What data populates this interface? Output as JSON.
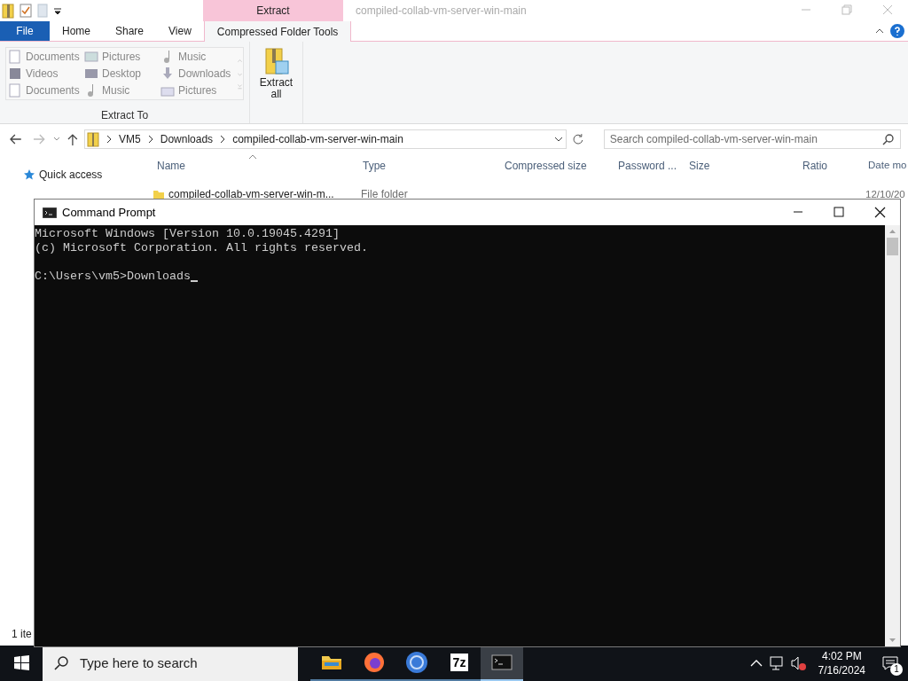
{
  "explorer": {
    "context_tab": "Extract",
    "title": "compiled-collab-vm-server-win-main",
    "tabs": [
      {
        "label": "File",
        "kind": "file",
        "selected": false
      },
      {
        "label": "Home",
        "kind": "tab",
        "selected": false
      },
      {
        "label": "Share",
        "kind": "tab",
        "selected": false
      },
      {
        "label": "View",
        "kind": "tab",
        "selected": false
      },
      {
        "label": "Compressed Folder Tools",
        "kind": "tab",
        "selected": true
      }
    ],
    "extract_to": {
      "items": [
        "Documents",
        "Pictures",
        "Music",
        "Videos",
        "Desktop",
        "Downloads",
        "Documents",
        "Music",
        "Pictures"
      ],
      "group_label": "Extract To"
    },
    "extract_all": "Extract\nall",
    "breadcrumb": [
      "VM5",
      "Downloads",
      "compiled-collab-vm-server-win-main"
    ],
    "search": {
      "placeholder": "Search compiled-collab-vm-server-win-main"
    },
    "columns": [
      "Name",
      "Type",
      "Compressed size",
      "Password ...",
      "Size",
      "Ratio",
      "Date mo"
    ],
    "rows": [
      {
        "name": "compiled-collab-vm-server-win-m...",
        "type": "File folder",
        "date": "12/10/20"
      }
    ],
    "nav": {
      "quick_access": "Quick access"
    },
    "status": "1 ite"
  },
  "cmd": {
    "title": "Command Prompt",
    "paragraphs": [
      [
        "Microsoft Windows [Version 10.0.19045.4291]",
        "(c) Microsoft Corporation. All rights reserved."
      ],
      [
        "C:\\Users\\vm5>Downloads"
      ]
    ]
  },
  "taskbar": {
    "search_placeholder": "Type here to search",
    "apps": [
      {
        "kind": "folder",
        "selected": false
      },
      {
        "kind": "firefox",
        "selected": false
      },
      {
        "kind": "chrome",
        "selected": false
      },
      {
        "kind": "sevenzip",
        "label": "7z",
        "selected": false
      },
      {
        "kind": "cmd",
        "selected": true
      }
    ],
    "time": "4:02 PM",
    "date": "7/16/2024",
    "notifications": "1"
  }
}
